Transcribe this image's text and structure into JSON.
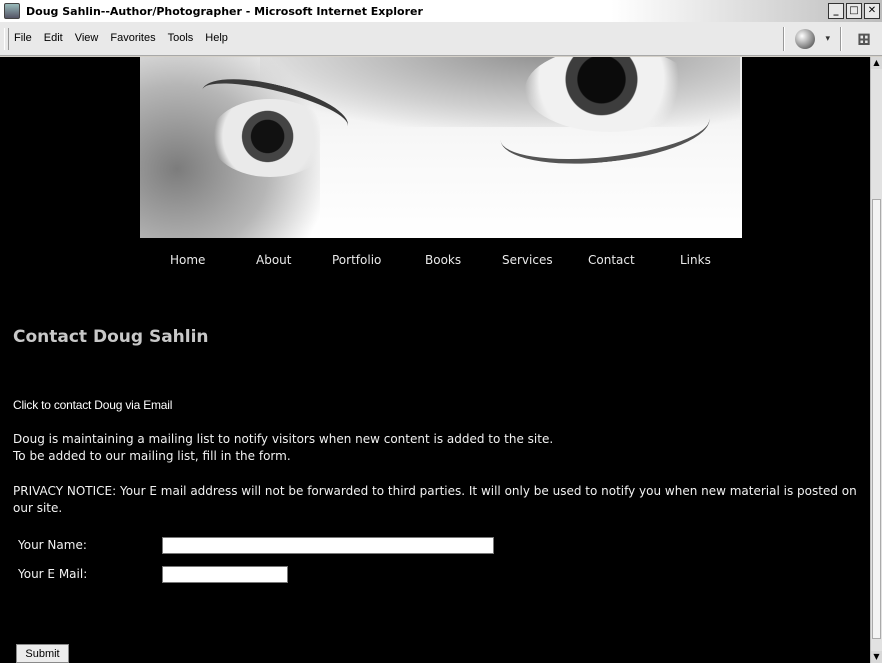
{
  "window": {
    "title": "Doug Sahlin--Author/Photographer - Microsoft Internet Explorer",
    "minimize": "_",
    "maximize": "□",
    "close": "✕"
  },
  "menu": {
    "items": [
      "File",
      "Edit",
      "View",
      "Favorites",
      "Tools",
      "Help"
    ]
  },
  "toolbar": {
    "icons": [
      "globe-icon",
      "dropdown-arrow-icon",
      "windows-logo-icon"
    ],
    "dropdown_glyph": "▾",
    "logo_glyph": "⊞"
  },
  "nav": {
    "home": "Home",
    "about": "About",
    "portfolio": "Portfolio",
    "books": "Books",
    "services": "Services",
    "contact": "Contact",
    "links": "Links"
  },
  "page": {
    "heading": "Contact Doug Sahlin",
    "email_link": "Click to contact Doug via Email",
    "mailing_line1": "Doug is maintaining a mailing list to notify visitors when new content is added to the site.",
    "mailing_line2": "To be added to our mailing list, fill in the form.",
    "privacy": "PRIVACY NOTICE: Your E mail address will not be forwarded to third parties. It will only be used to notify you when new material is posted on our site."
  },
  "form": {
    "name_label": "Your Name:",
    "name_value": "",
    "email_label": "Your E Mail:",
    "email_value": "",
    "submit_label": "Submit"
  },
  "scrollbar": {
    "up_glyph": "▲",
    "down_glyph": "▼"
  },
  "colors": {
    "page_background": "#000000",
    "heading": "#c8c8c8",
    "text": "#f2f2f2"
  }
}
